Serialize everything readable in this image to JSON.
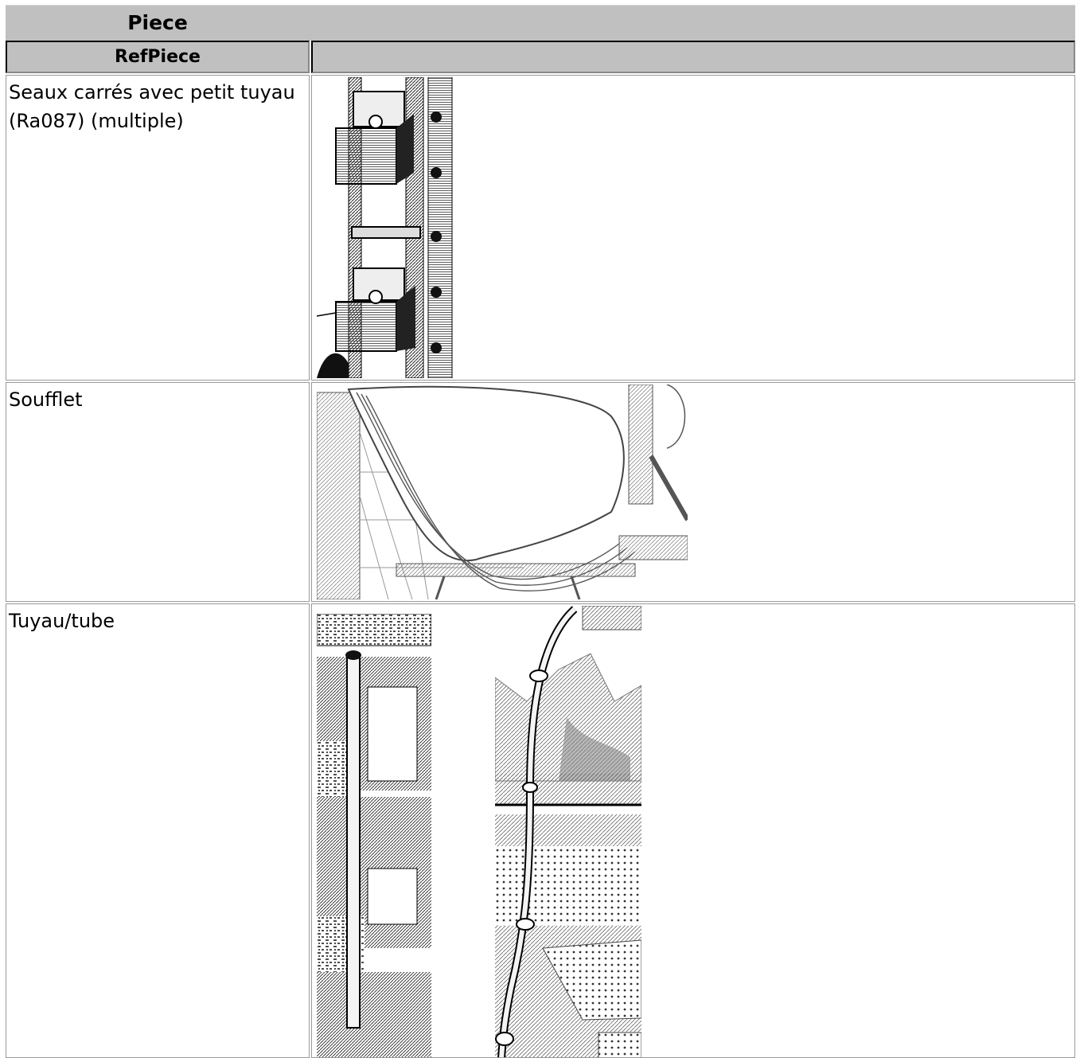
{
  "table": {
    "title": "Piece",
    "columns": [
      "RefPiece",
      ""
    ],
    "rows": [
      {
        "label": "Seaux carrés avec petit tuyau (Ra087) (multiple)",
        "images": [
          {
            "icon": "engraving-square-buckets-chain"
          }
        ]
      },
      {
        "label": "Soufflet",
        "images": [
          {
            "icon": "engraving-bellows"
          }
        ]
      },
      {
        "label": "Tuyau/tube",
        "images": [
          {
            "icon": "engraving-vertical-pipe"
          },
          {
            "icon": "engraving-curved-pipe-landscape"
          }
        ]
      }
    ]
  },
  "colors": {
    "header_bg": "#c0c0c0",
    "border": "#9a9a9a"
  }
}
